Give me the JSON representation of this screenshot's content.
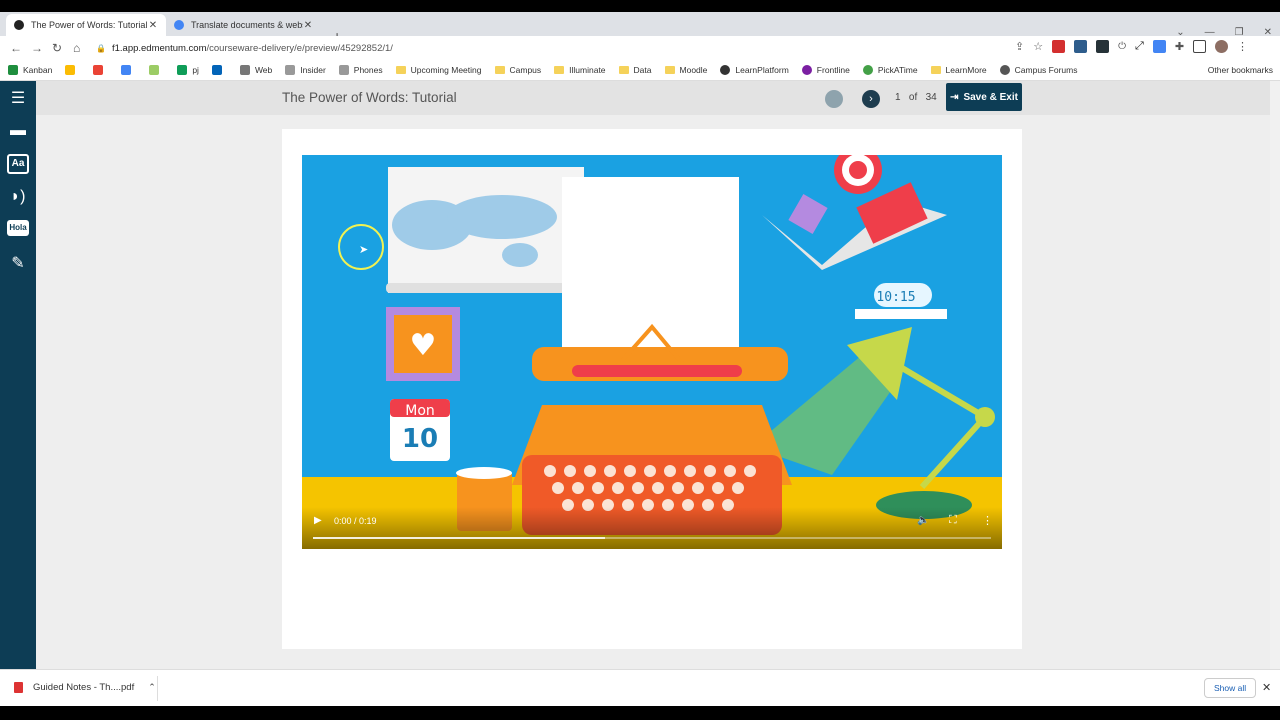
{
  "browser": {
    "tabs": [
      {
        "title": "The Power of Words: Tutorial",
        "active": true
      },
      {
        "title": "Translate documents & websites",
        "active": false
      }
    ],
    "url_host": "f1.app.edmentum.com",
    "url_path": "/courseware-delivery/e/preview/45292852/1/",
    "bookmarks": [
      "Kanban",
      "Web",
      "Insider",
      "Phones",
      "Upcoming Meeting",
      "Campus",
      "Illuminate",
      "Data",
      "Moodle",
      "LearnPlatform",
      "Frontline",
      "PickATime",
      "LearnMore",
      "Campus Forums"
    ],
    "bookmark_extra": "pj",
    "other_bookmarks": "Other bookmarks"
  },
  "lesson": {
    "title": "The Power of Words: Tutorial",
    "page_current": "1",
    "page_of": "of",
    "page_total": "34",
    "save_exit": "Save & Exit"
  },
  "video": {
    "time": "0:00 / 0:19",
    "buffered_fraction": 0.43,
    "calendar_day": "Mon",
    "calendar_date": "10",
    "clock": "10:15"
  },
  "downloads": {
    "file": "Guided Notes - Th....pdf",
    "show_all": "Show all"
  },
  "colors": {
    "sidebar": "#0d3d55",
    "video_bg": "#1aa1e2",
    "accent_orange": "#f7931e"
  }
}
